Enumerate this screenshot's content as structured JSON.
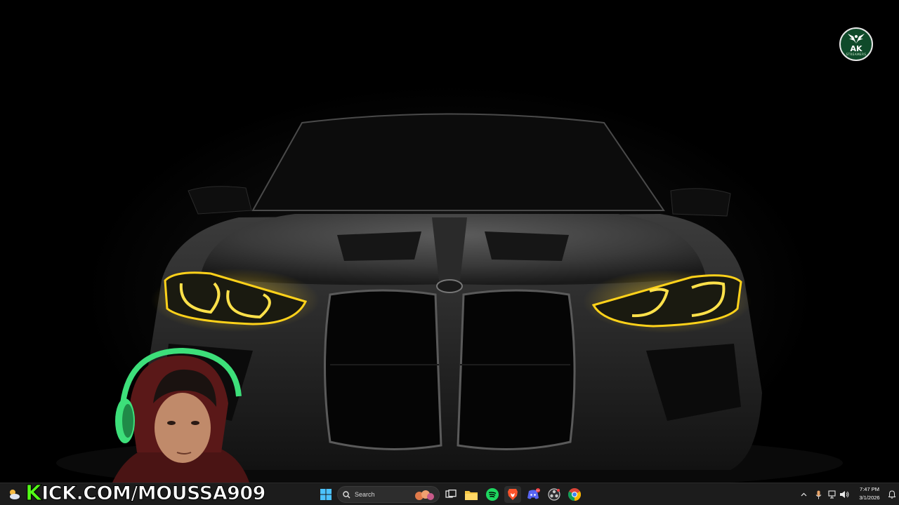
{
  "stream_overlay": {
    "kick_letter": "K",
    "kick_url_rest": "ICK.COM/MOUSSA909",
    "brand_logo_text": "AK",
    "brand_logo_subtext": "STREAMERS"
  },
  "taskbar": {
    "search_placeholder": "Search",
    "apps": [
      "task-view",
      "file-explorer",
      "spotify",
      "brave",
      "discord",
      "obs",
      "chrome"
    ],
    "notification_badges": {
      "discord": "9+"
    }
  },
  "system_tray": {
    "time": "7:47 PM",
    "date": "3/1/2026"
  },
  "colors": {
    "kick_green": "#53fc18",
    "taskbar_bg": "#1c1c1c",
    "headlight_yellow": "#ffd21a",
    "logo_green": "#0f4a2a"
  }
}
